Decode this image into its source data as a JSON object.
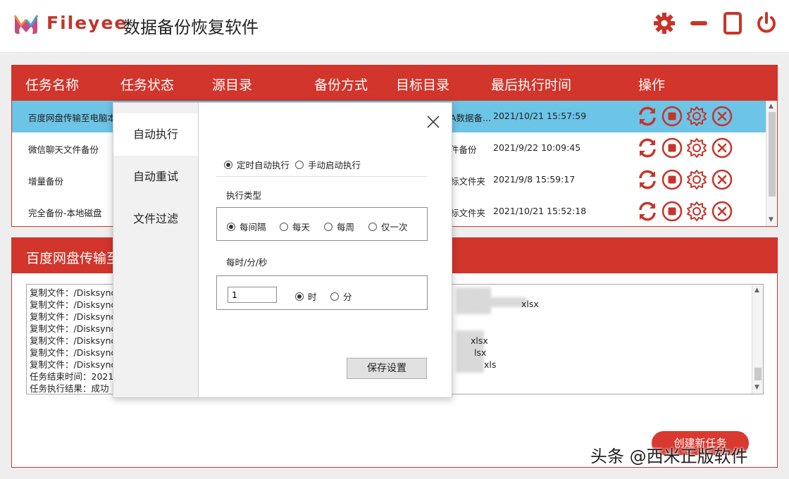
{
  "app": {
    "brand": "Fileyee",
    "title": "数据备份恢复软件"
  },
  "header_icons": [
    "gear-icon",
    "minimize-icon",
    "maximize-icon",
    "power-icon"
  ],
  "colors": {
    "accent": "#d1352b",
    "selected_row": "#6cc4e6"
  },
  "table": {
    "headers": [
      "任务名称",
      "任务状态",
      "源目录",
      "备份方式",
      "目标目录",
      "最后执行时间",
      "操作"
    ],
    "rows": [
      {
        "name": "百度网盘传输至电脑本",
        "target": "A数据备...",
        "last_run": "2021/10/21 15:57:59",
        "selected": true
      },
      {
        "name": "微信聊天文件备份",
        "target": "件备份",
        "last_run": "2021/9/22 10:09:45",
        "selected": false
      },
      {
        "name": "增量备份",
        "target": "标文件夹",
        "last_run": "2021/9/8 15:59:17",
        "selected": false
      },
      {
        "name": "完全备份-本地磁盘",
        "target": "标文件夹",
        "last_run": "2021/10/21 15:52:18",
        "selected": false
      }
    ],
    "row_actions": [
      "refresh-icon",
      "stop-icon",
      "settings-icon",
      "delete-icon"
    ]
  },
  "log": {
    "title": "百度网盘传输至",
    "lines": [
      "复制文件：/Disksync数",
      "复制文件：/Disksync数",
      "复制文件：/Disksync数",
      "复制文件：/Disksync数",
      "复制文件：/Disksync数",
      "复制文件：/Disksync数",
      "复制文件：/Disksync数",
      "任务结束时间：2021/",
      "任务执行结果：成功"
    ],
    "right_fragments": [
      "xlsx",
      "xlsx",
      "lsx",
      "xls"
    ],
    "create_button": "创建新任务"
  },
  "dialog": {
    "tabs": [
      "自动执行",
      "自动重试",
      "文件过滤"
    ],
    "active_tab": 0,
    "mode_options": [
      {
        "label": "定时自动执行",
        "checked": true
      },
      {
        "label": "手动启动执行",
        "checked": false
      }
    ],
    "exec_type_label": "执行类型",
    "exec_type_options": [
      {
        "label": "每间隔",
        "checked": true
      },
      {
        "label": "每天",
        "checked": false
      },
      {
        "label": "每周",
        "checked": false
      },
      {
        "label": "仅一次",
        "checked": false
      }
    ],
    "interval_label": "每时/分/秒",
    "interval_value": "1",
    "unit_options": [
      {
        "label": "时",
        "checked": true
      },
      {
        "label": "分",
        "checked": false
      }
    ],
    "save_button": "保存设置"
  },
  "watermark": "头条 @西米正版软件"
}
